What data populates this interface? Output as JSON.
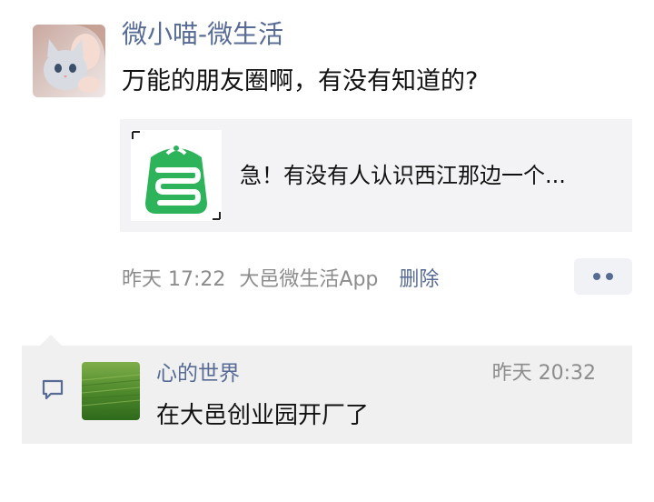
{
  "post": {
    "author_name": "微小喵-微生活",
    "text": "万能的朋友圈啊，有没有知道的?",
    "link": {
      "title": "急！有没有人认识西江那边一个..."
    },
    "meta": {
      "time": "昨天 17:22",
      "source": "大邑微生活App",
      "delete_label": "删除"
    }
  },
  "comments": [
    {
      "name": "心的世界",
      "time": "昨天 20:32",
      "text": "在大邑创业园开厂了"
    }
  ],
  "icons": {
    "author_avatar": "cat-photo-avatar",
    "link_thumbnail": "green-app-logo-icon",
    "more": "more-dots-icon",
    "comment": "comment-bubble-icon",
    "commenter_avatar": "grass-field-avatar"
  },
  "colors": {
    "name_link": "#576b95",
    "meta_gray": "#8c8c8c",
    "card_bg": "#f3f3f5",
    "comment_bg": "#f0f0f0",
    "app_logo_green": "#2db45a"
  }
}
